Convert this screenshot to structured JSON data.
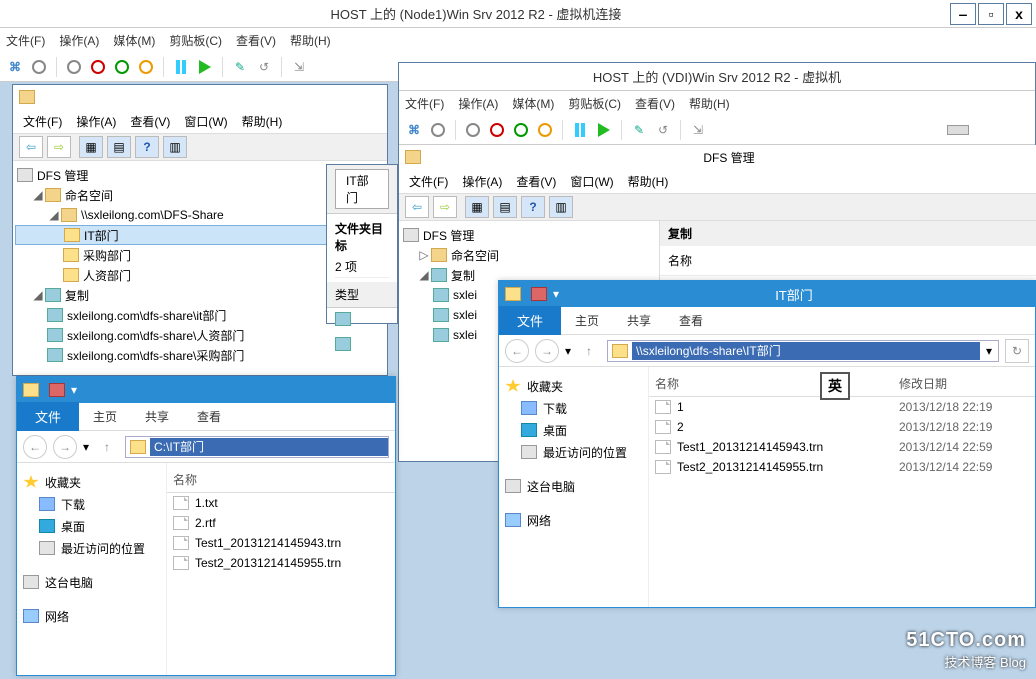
{
  "node1": {
    "title": "HOST 上的 (Node1)Win Srv 2012 R2 - 虚拟机连接",
    "menu": [
      "文件(F)",
      "操作(A)",
      "媒体(M)",
      "剪贴板(C)",
      "查看(V)",
      "帮助(H)"
    ]
  },
  "vdi": {
    "title": "HOST 上的 (VDI)Win Srv 2012 R2 - 虚拟机",
    "menu": [
      "文件(F)",
      "操作(A)",
      "媒体(M)",
      "剪贴板(C)",
      "查看(V)",
      "帮助(H)"
    ]
  },
  "mmc1": {
    "menu": [
      "文件(F)",
      "操作(A)",
      "查看(V)",
      "窗口(W)",
      "帮助(H)"
    ],
    "tree": {
      "root": "DFS 管理",
      "ns": "命名空间",
      "share": "\\\\sxleilong.com\\DFS-Share",
      "it": "IT部门",
      "pur": "采购部门",
      "hr": "人资部门",
      "rep": "复制",
      "r1": "sxleilong.com\\dfs-share\\it部门",
      "r2": "sxleilong.com\\dfs-share\\人资部门",
      "r3": "sxleilong.com\\dfs-share\\采购部门"
    }
  },
  "mmc2": {
    "title": "DFS 管理",
    "menu": [
      "文件(F)",
      "操作(A)",
      "查看(V)",
      "窗口(W)",
      "帮助(H)"
    ],
    "tree": {
      "root": "DFS 管理",
      "ns": "命名空间",
      "rep": "复制",
      "r1": "sxlei",
      "r2": "sxlei",
      "r3": "sxlei"
    },
    "right": {
      "hdr": "复制",
      "col": "名称"
    }
  },
  "panel1": {
    "tab": "IT部门",
    "label": "文件夹目标",
    "count": "2 项",
    "col1": "类型"
  },
  "exp1": {
    "tabs": {
      "file": "文件",
      "home": "主页",
      "share": "共享",
      "view": "查看"
    },
    "path": "C:\\IT部门",
    "side": {
      "fav": "收藏夹",
      "dl": "下载",
      "desk": "桌面",
      "recent": "最近访问的位置",
      "pc": "这台电脑",
      "net": "网络"
    },
    "cols": {
      "name": "名称"
    },
    "files": [
      {
        "n": "1.txt"
      },
      {
        "n": "2.rtf"
      },
      {
        "n": "Test1_20131214145943.trn"
      },
      {
        "n": "Test2_20131214145955.trn"
      }
    ]
  },
  "exp2": {
    "title": "IT部门",
    "tabs": {
      "file": "文件",
      "home": "主页",
      "share": "共享",
      "view": "查看"
    },
    "path": "\\\\sxleilong\\dfs-share\\IT部门",
    "side": {
      "fav": "收藏夹",
      "dl": "下载",
      "desk": "桌面",
      "recent": "最近访问的位置",
      "pc": "这台电脑",
      "net": "网络"
    },
    "cols": {
      "name": "名称",
      "date": "修改日期"
    },
    "files": [
      {
        "n": "1",
        "d": "2013/12/18 22:19"
      },
      {
        "n": "2",
        "d": "2013/12/18 22:19"
      },
      {
        "n": "Test1_20131214145943.trn",
        "d": "2013/12/14 22:59"
      },
      {
        "n": "Test2_20131214145955.trn",
        "d": "2013/12/14 22:59"
      }
    ]
  },
  "ime": "英",
  "watermark": {
    "big": "51CTO.com",
    "sm": "技术博客  Blog"
  }
}
